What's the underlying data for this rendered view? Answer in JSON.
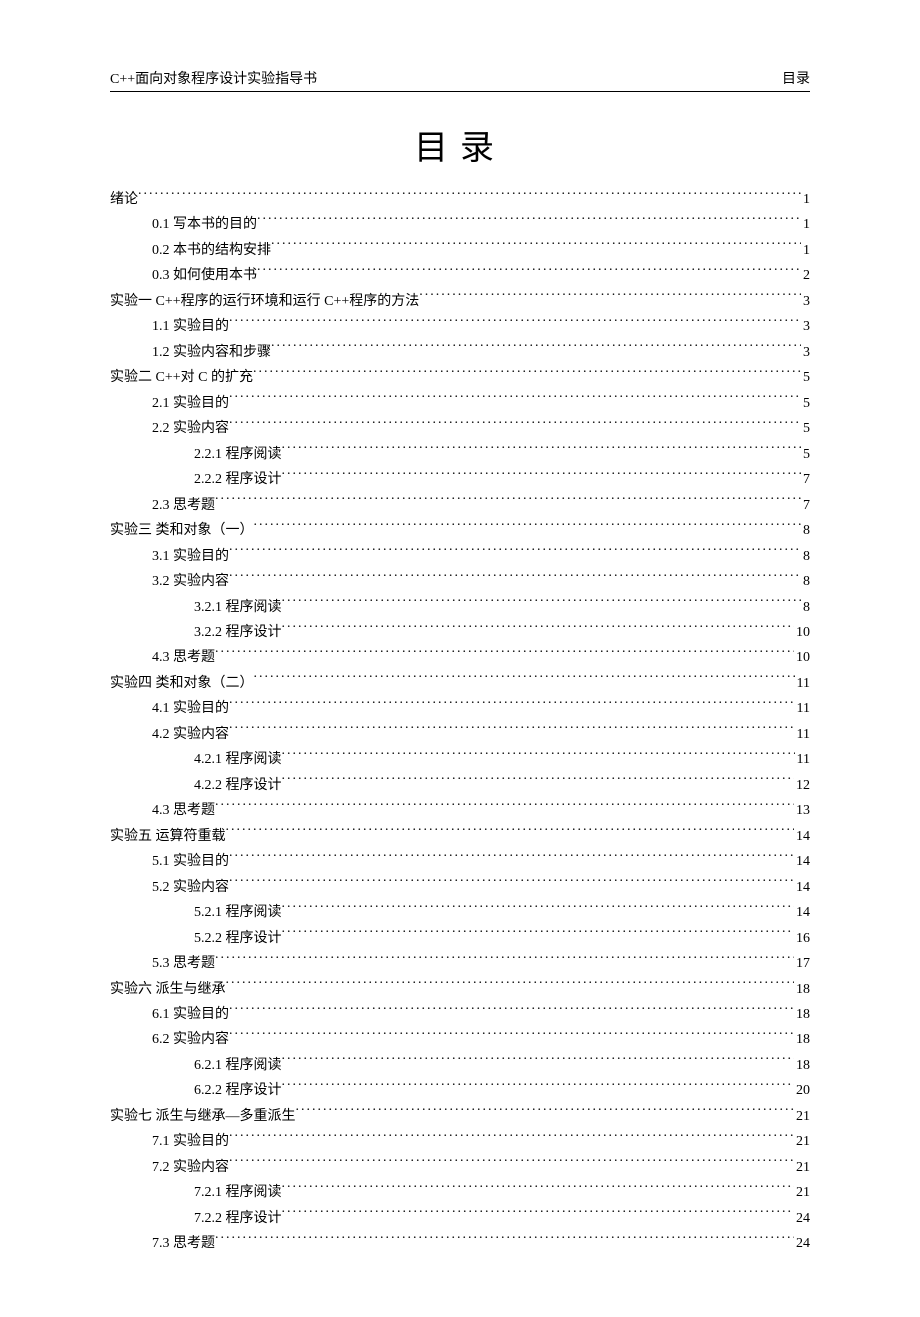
{
  "header": {
    "left": "C++面向对象程序设计实验指导书",
    "right": "目录"
  },
  "title": "目录",
  "toc": [
    {
      "level": 0,
      "text": "绪论",
      "page": "1"
    },
    {
      "level": 1,
      "text": "0.1  写本书的目的",
      "page": "1"
    },
    {
      "level": 1,
      "text": "0.2  本书的结构安排",
      "page": "1"
    },
    {
      "level": 1,
      "text": "0.3  如何使用本书",
      "page": "2"
    },
    {
      "level": 0,
      "text": "实验一  C++程序的运行环境和运行 C++程序的方法",
      "page": "3"
    },
    {
      "level": 1,
      "text": "1.1  实验目的",
      "page": "3"
    },
    {
      "level": 1,
      "text": "1.2 实验内容和步骤",
      "page": "3"
    },
    {
      "level": 0,
      "text": "实验二  C++对 C  的扩充",
      "page": "5"
    },
    {
      "level": 1,
      "text": "2.1  实验目的",
      "page": "5"
    },
    {
      "level": 1,
      "text": "2.2  实验内容",
      "page": "5"
    },
    {
      "level": 2,
      "text": "2.2.1  程序阅读",
      "page": "5"
    },
    {
      "level": 2,
      "text": "2.2.2  程序设计",
      "page": "7"
    },
    {
      "level": 1,
      "text": "2.3  思考题",
      "page": "7"
    },
    {
      "level": 0,
      "text": "实验三  类和对象（一）",
      "page": "8"
    },
    {
      "level": 1,
      "text": "3.1  实验目的",
      "page": "8"
    },
    {
      "level": 1,
      "text": "3.2  实验内容",
      "page": "8"
    },
    {
      "level": 2,
      "text": "3.2.1 程序阅读",
      "page": "8"
    },
    {
      "level": 2,
      "text": "3.2.2  程序设计",
      "page": "10"
    },
    {
      "level": 1,
      "text": "4.3 思考题",
      "page": "10"
    },
    {
      "level": 0,
      "text": "实验四  类和对象（二）",
      "page": "11"
    },
    {
      "level": 1,
      "text": "4.1  实验目的",
      "page": "11"
    },
    {
      "level": 1,
      "text": "4.2  实验内容",
      "page": "11"
    },
    {
      "level": 2,
      "text": "4.2.1 程序阅读",
      "page": "11"
    },
    {
      "level": 2,
      "text": "4.2.2  程序设计",
      "page": "12"
    },
    {
      "level": 1,
      "text": "4.3 思考题",
      "page": "13"
    },
    {
      "level": 0,
      "text": "实验五  运算符重载",
      "page": "14"
    },
    {
      "level": 1,
      "text": "5.1  实验目的",
      "page": "14"
    },
    {
      "level": 1,
      "text": "5.2  实验内容",
      "page": "14"
    },
    {
      "level": 2,
      "text": "5.2.1 程序阅读",
      "page": "14"
    },
    {
      "level": 2,
      "text": "5.2.2  程序设计",
      "page": "16"
    },
    {
      "level": 1,
      "text": "5.3 思考题",
      "page": "17"
    },
    {
      "level": 0,
      "text": "实验六  派生与继承",
      "page": "18"
    },
    {
      "level": 1,
      "text": "6.1  实验目的",
      "page": "18"
    },
    {
      "level": 1,
      "text": "6.2  实验内容",
      "page": "18"
    },
    {
      "level": 2,
      "text": "6.2.1 程序阅读",
      "page": "18"
    },
    {
      "level": 2,
      "text": "6.2.2  程序设计",
      "page": "20"
    },
    {
      "level": 0,
      "text": "实验七  派生与继承—多重派生",
      "page": "21"
    },
    {
      "level": 1,
      "text": "7.1  实验目的",
      "page": "21"
    },
    {
      "level": 1,
      "text": "7.2  实验内容",
      "page": "21"
    },
    {
      "level": 2,
      "text": "7.2.1 程序阅读",
      "page": "21"
    },
    {
      "level": 2,
      "text": "7.2.2  程序设计",
      "page": "24"
    },
    {
      "level": 1,
      "text": "7.3 思考题",
      "page": "24"
    }
  ]
}
